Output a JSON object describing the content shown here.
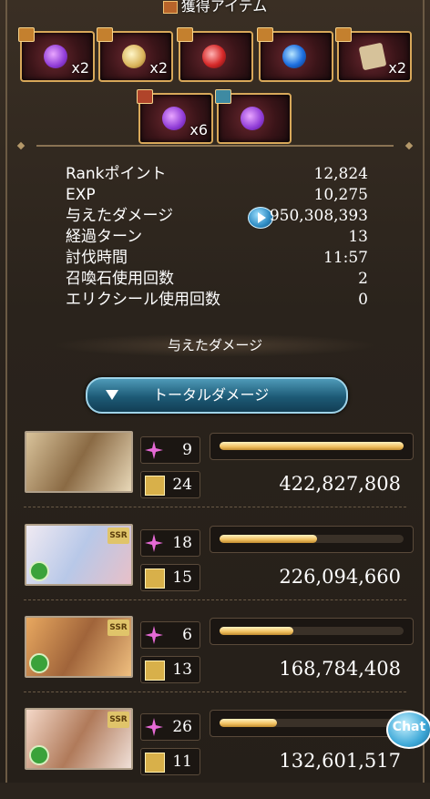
{
  "header": {
    "title": "獲得アイテム"
  },
  "items": {
    "row1": [
      {
        "icon": "purple-flame-item-icon",
        "count": "x2"
      },
      {
        "icon": "gold-crystal-item-icon",
        "count": "x2"
      },
      {
        "icon": "red-orb-item-icon",
        "count": ""
      },
      {
        "icon": "blue-orb-item-icon",
        "count": ""
      },
      {
        "icon": "scroll-item-icon",
        "count": "x2"
      }
    ],
    "row2": [
      {
        "icon": "purple-flame-item-icon",
        "count": "x6"
      },
      {
        "icon": "purple-flame-item-icon",
        "count": ""
      }
    ]
  },
  "stats": [
    {
      "label": "Rankポイント",
      "value": "12,824"
    },
    {
      "label": "EXP",
      "value": "10,275"
    },
    {
      "label": "与えたダメージ",
      "value": "950,308,393"
    },
    {
      "label": "経過ターン",
      "value": "13"
    },
    {
      "label": "討伐時間",
      "value": "11:57"
    },
    {
      "label": "召喚石使用回数",
      "value": "2"
    },
    {
      "label": "エリクシール使用回数",
      "value": "0"
    }
  ],
  "section": {
    "title": "与えたダメージ"
  },
  "dropdown": {
    "label": "トータルダメージ"
  },
  "characters": [
    {
      "attacks": "9",
      "ca": "24",
      "damage": "422,827,808",
      "bar_fraction": 1.0,
      "rarity": ""
    },
    {
      "attacks": "18",
      "ca": "15",
      "damage": "226,094,660",
      "bar_fraction": 0.53,
      "rarity": "SSR"
    },
    {
      "attacks": "6",
      "ca": "13",
      "damage": "168,784,408",
      "bar_fraction": 0.4,
      "rarity": "SSR"
    },
    {
      "attacks": "26",
      "ca": "11",
      "damage": "132,601,517",
      "bar_fraction": 0.31,
      "rarity": "SSR"
    }
  ],
  "chat": {
    "label": "Chat"
  }
}
